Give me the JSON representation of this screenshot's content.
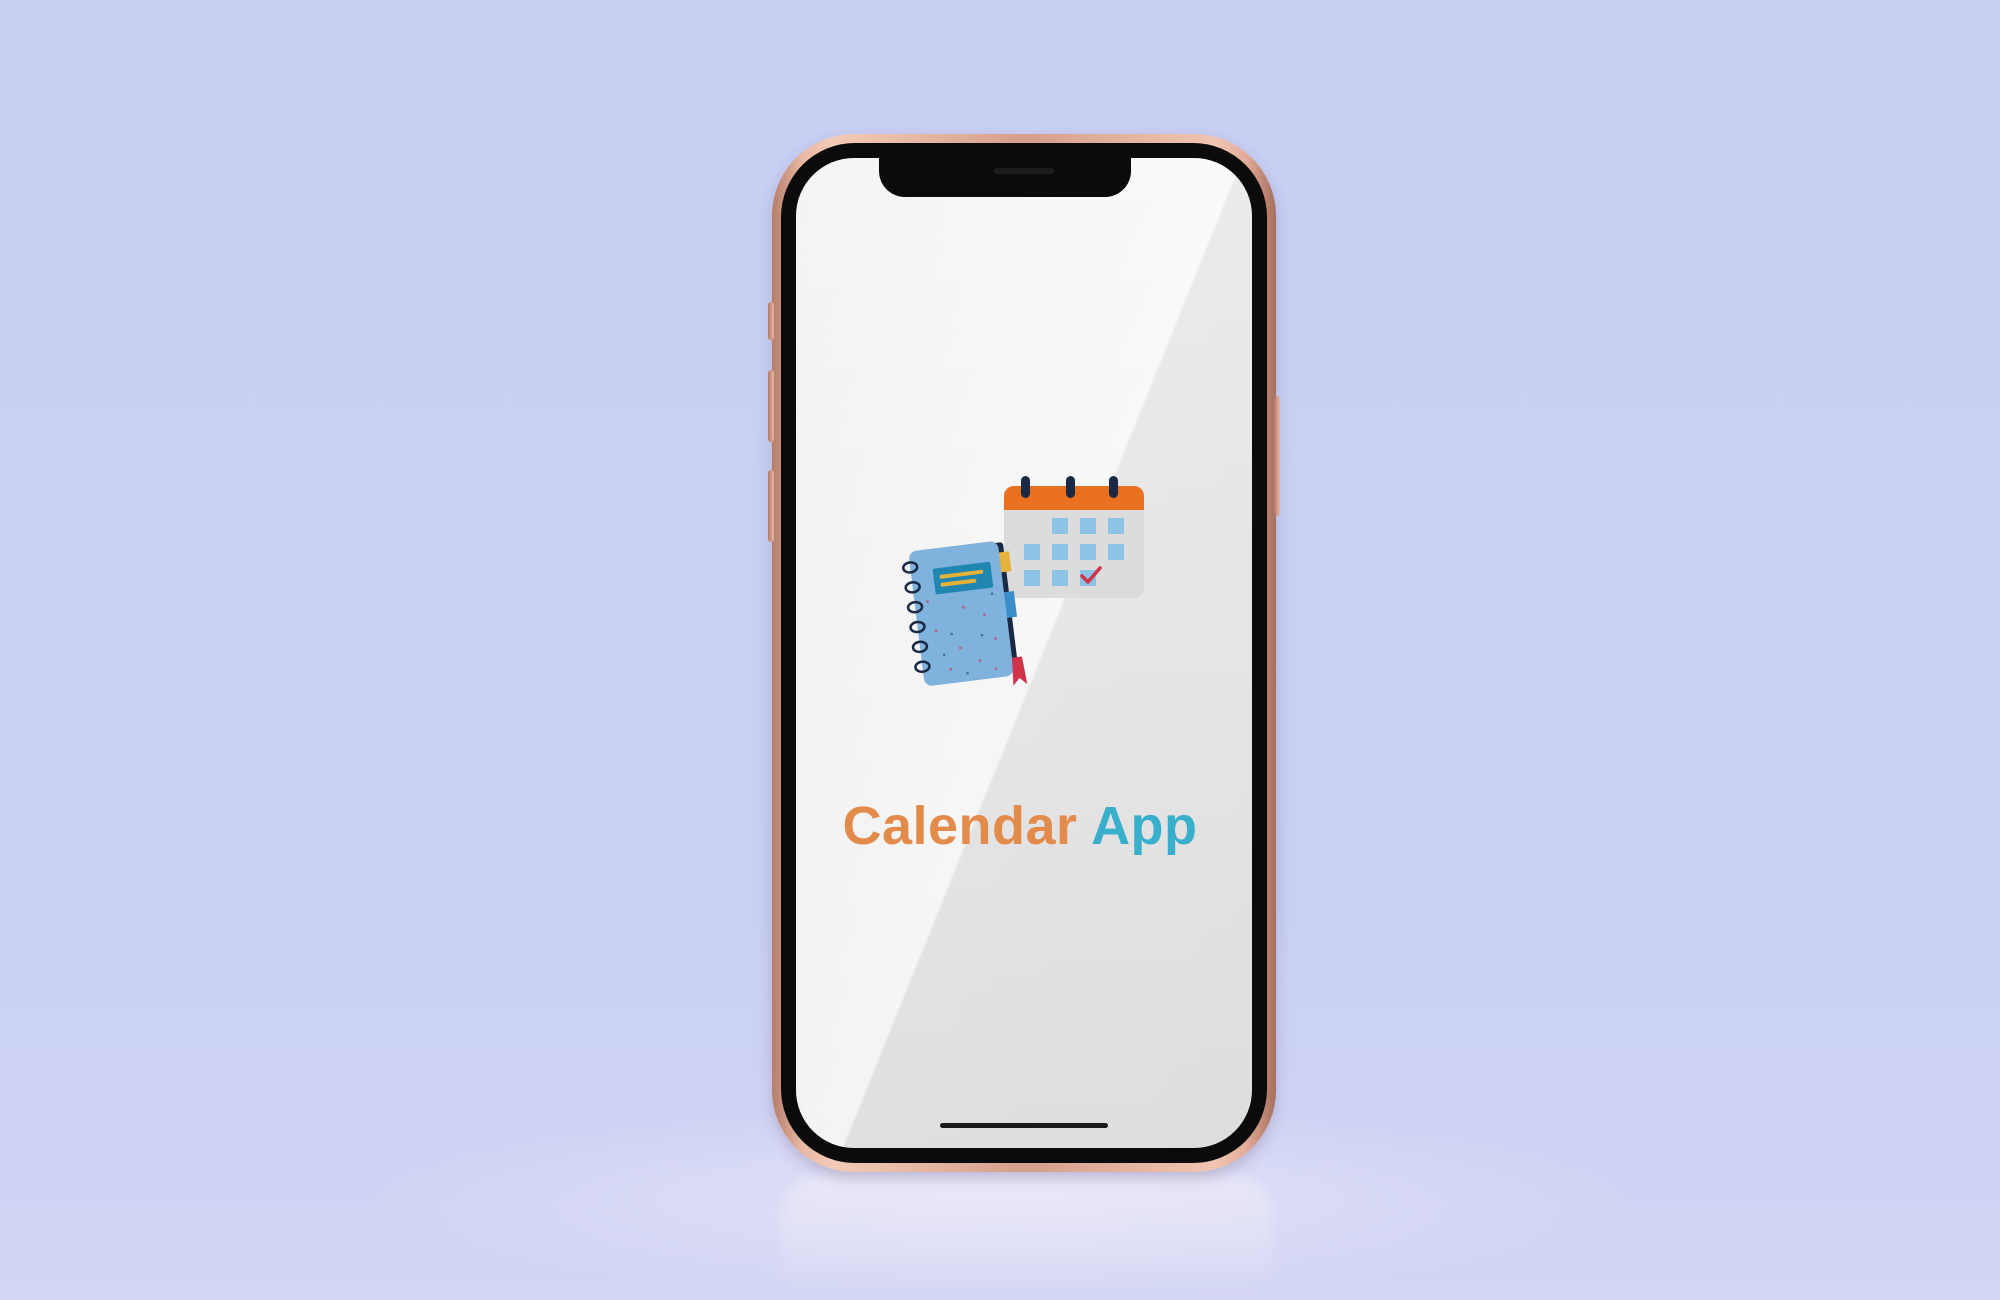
{
  "app": {
    "title_part_1": "Calendar",
    "title_part_2": "App"
  },
  "colors": {
    "background": "#c8cff3",
    "title_primary": "#e38b4a",
    "title_accent": "#3aafcc",
    "calendar_header": "#e8701e",
    "calendar_cells": "#8cc3e6",
    "notebook_cover": "#7fb2dc",
    "bookmark": "#d0334a",
    "phone_frame": "#e2ad99"
  },
  "icons": {
    "illustration": "calendar-notebook-illustration"
  }
}
